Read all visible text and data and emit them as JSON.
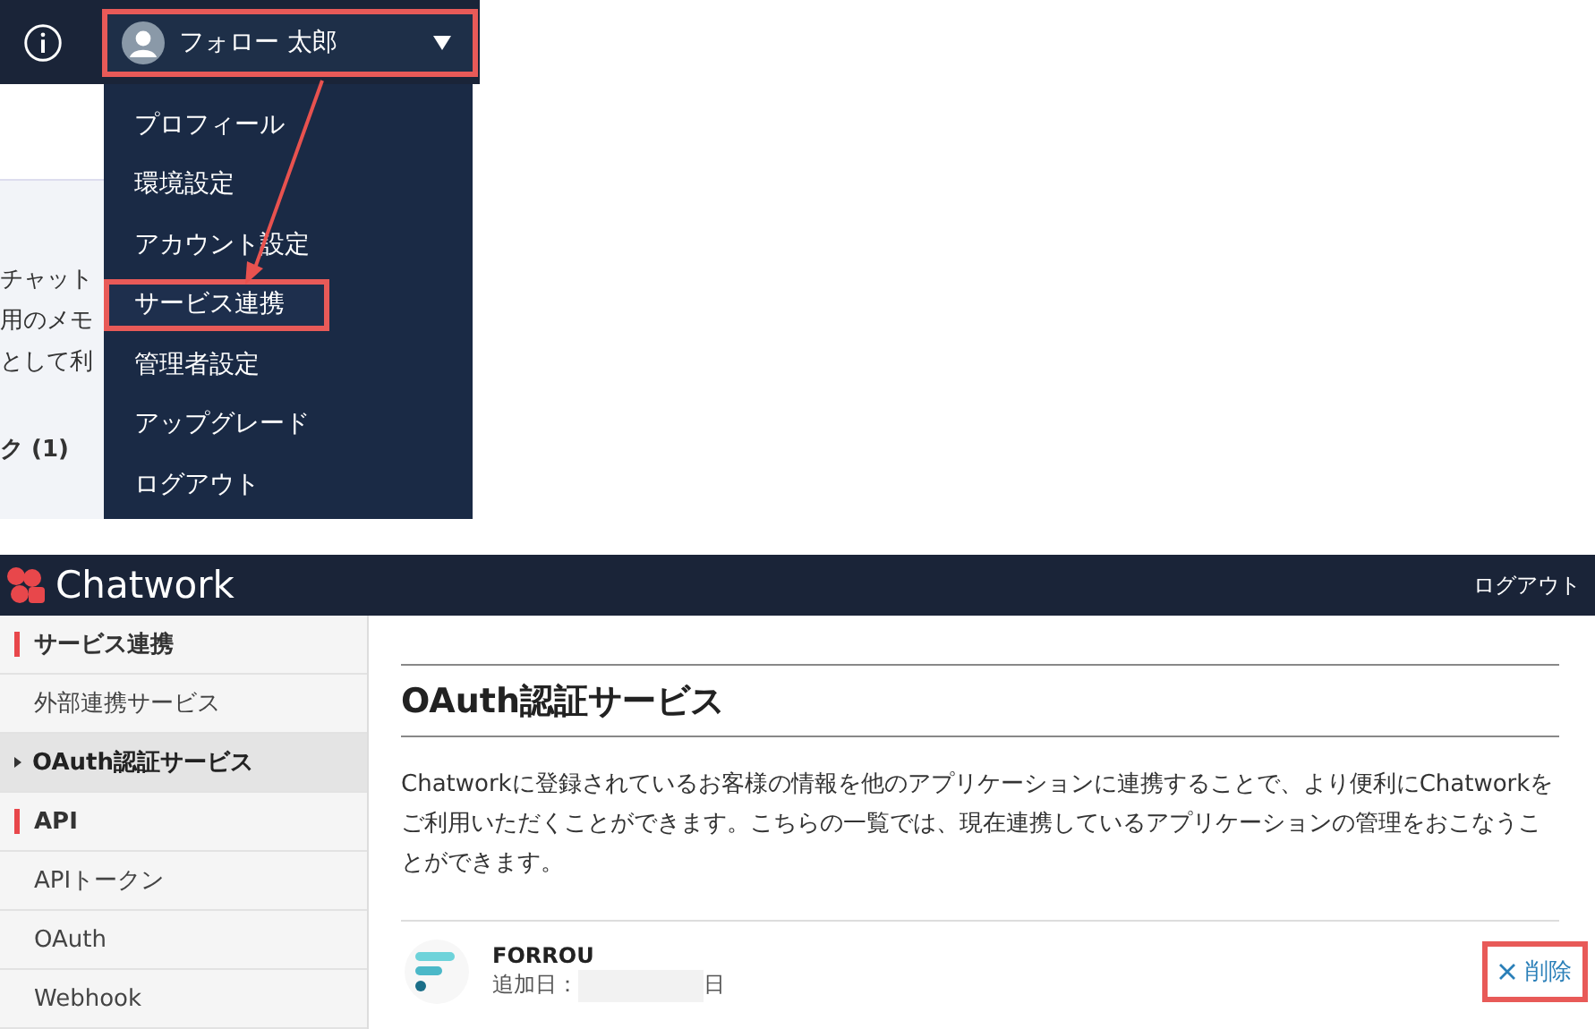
{
  "top_screenshot": {
    "background_texts": [
      "チャット",
      "用のメモ",
      "として利",
      "ク (1)"
    ],
    "user_menu": {
      "name": "フォロー 太郎",
      "highlighted": true
    },
    "dropdown": [
      {
        "label": "プロフィール",
        "highlighted": false
      },
      {
        "label": "環境設定",
        "highlighted": false
      },
      {
        "label": "アカウント設定",
        "highlighted": false
      },
      {
        "label": "サービス連携",
        "highlighted": true
      },
      {
        "label": "管理者設定",
        "highlighted": false
      },
      {
        "label": "アップグレード",
        "highlighted": false
      },
      {
        "label": "ログアウト",
        "highlighted": false
      }
    ]
  },
  "bottom_screenshot": {
    "header": {
      "brand": "Chatwork",
      "logout": "ログアウト"
    },
    "sidebar": [
      {
        "kind": "heading",
        "label": "サービス連携"
      },
      {
        "kind": "item",
        "label": "外部連携サービス",
        "selected": false
      },
      {
        "kind": "item",
        "label": "OAuth認証サービス",
        "selected": true
      },
      {
        "kind": "heading",
        "label": "API"
      },
      {
        "kind": "item",
        "label": "APIトークン",
        "selected": false
      },
      {
        "kind": "item",
        "label": "OAuth",
        "selected": false
      },
      {
        "kind": "item",
        "label": "Webhook",
        "selected": false
      }
    ],
    "page": {
      "title": "OAuth認証サービス",
      "description": "Chatworkに登録されているお客様の情報を他のアプリケーションに連携することで、より便利にChatworkをご利用いただくことができます。こちらの一覧では、現在連携しているアプリケーションの管理をおこなうことができます。",
      "apps": [
        {
          "name": "FORROU",
          "added_label": "追加日：",
          "added_suffix": "日",
          "delete": "削除",
          "highlighted": true
        }
      ]
    }
  }
}
